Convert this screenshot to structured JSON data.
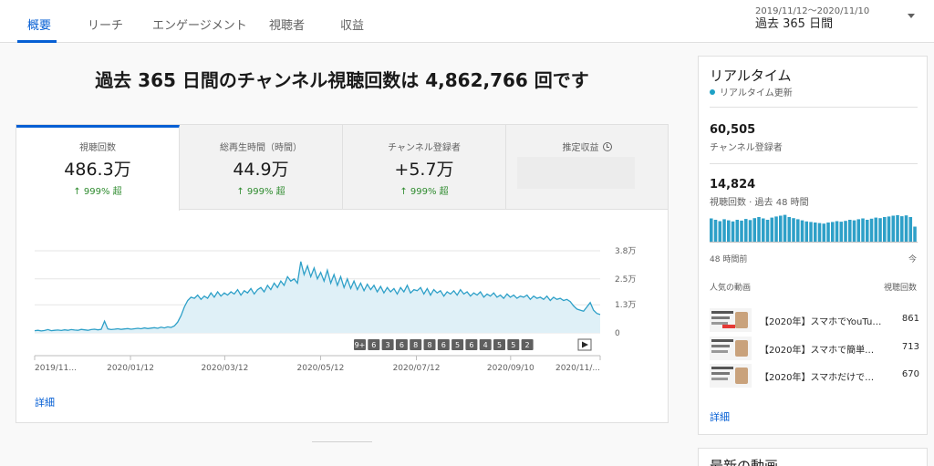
{
  "tabs": [
    {
      "label": "概要"
    },
    {
      "label": "リーチ"
    },
    {
      "label": "エンゲージメント"
    },
    {
      "label": "視聴者"
    },
    {
      "label": "収益"
    }
  ],
  "date_selector": {
    "range": "2019/11/12〜2020/11/10",
    "label": "過去 365 日間"
  },
  "headline": "過去 365 日間のチャンネル視聴回数は 4,862,766 回です",
  "metrics": [
    {
      "label": "視聴回数",
      "value": "486.3万",
      "delta": "↑ 999% 超"
    },
    {
      "label": "総再生時間（時間）",
      "value": "44.9万",
      "delta": "↑ 999% 超"
    },
    {
      "label": "チャンネル登録者",
      "value": "+5.7万",
      "delta": "↑ 999% 超"
    },
    {
      "label": "推定収益"
    }
  ],
  "chart_data": {
    "type": "area",
    "y_ticks": [
      "3.8万",
      "2.5万",
      "1.3万",
      "0"
    ],
    "ylim": [
      0,
      38000
    ],
    "x_labels": [
      "2019/11...",
      "2020/01/12",
      "2020/03/12",
      "2020/05/12",
      "2020/07/12",
      "2020/09/10",
      "2020/11/..."
    ],
    "x_dates": [
      "2019-11-12",
      "2020-01-12",
      "2020-03-12",
      "2020-05-12",
      "2020-07-12",
      "2020-09-10",
      "2020-11-06"
    ],
    "series": [
      {
        "color": "#2ea0c8",
        "values": [
          1000,
          1200,
          900,
          1100,
          1500,
          1000,
          1200,
          1300,
          1100,
          1400,
          1200,
          1500,
          1300,
          1200,
          1600,
          1400,
          1200,
          1500,
          1700,
          1400,
          1600,
          5400,
          1800,
          1500,
          1700,
          1900,
          1600,
          1800,
          2000,
          1700,
          1900,
          2100,
          1900,
          2300,
          2000,
          2200,
          2400,
          2100,
          2600,
          2300,
          2800,
          2500,
          3200,
          5000,
          8000,
          12000,
          15000,
          16500,
          16000,
          17500,
          15500,
          17000,
          16000,
          18500,
          16500,
          19000,
          17000,
          18500,
          17500,
          19000,
          18000,
          20000,
          17500,
          19500,
          18500,
          20500,
          18000,
          20000,
          21000,
          19000,
          22000,
          20000,
          23000,
          21000,
          24000,
          22000,
          26000,
          24000,
          25000,
          23000,
          33000,
          27000,
          31000,
          26000,
          30000,
          25000,
          28000,
          24000,
          29000,
          23000,
          27000,
          22000,
          26000,
          21000,
          25000,
          20500,
          24000,
          20000,
          23000,
          19500,
          22500,
          20000,
          22000,
          19000,
          21500,
          18500,
          21000,
          19000,
          20500,
          18000,
          21000,
          19000,
          22000,
          18500,
          20000,
          19500,
          21000,
          18000,
          20500,
          17500,
          20000,
          18500,
          19500,
          17000,
          19000,
          18000,
          19500,
          17500,
          20000,
          18000,
          19000,
          17000,
          18500,
          17500,
          19000,
          16500,
          18000,
          17000,
          18500,
          16500,
          17500,
          16000,
          18000,
          16500,
          17500,
          16000,
          17000,
          16500,
          17500,
          15500,
          17000,
          16000,
          16500,
          15500,
          17000,
          15000,
          16500,
          15500,
          16000,
          15000,
          15500,
          14500,
          12500,
          11000,
          10500,
          10000,
          12000,
          14000,
          10500,
          9000,
          8500
        ]
      }
    ]
  },
  "chart_controls": {
    "markers": [
      "9+",
      "6",
      "3",
      "6",
      "8",
      "8",
      "6",
      "5",
      "6",
      "4",
      "5",
      "5",
      "2"
    ]
  },
  "main_more": "詳細",
  "realtime": {
    "title": "リアルタイム",
    "live_label": "リアルタイム更新",
    "subscribers": "60,505",
    "subscribers_label": "チャンネル登録者",
    "views": "14,824",
    "views_label": "視聴回数 · 過去 48 時間",
    "bars": [
      0.85,
      0.8,
      0.75,
      0.82,
      0.78,
      0.74,
      0.8,
      0.77,
      0.83,
      0.79,
      0.86,
      0.9,
      0.85,
      0.8,
      0.88,
      0.92,
      0.95,
      0.98,
      0.9,
      0.86,
      0.82,
      0.78,
      0.74,
      0.72,
      0.7,
      0.68,
      0.66,
      0.7,
      0.72,
      0.75,
      0.73,
      0.76,
      0.8,
      0.78,
      0.82,
      0.85,
      0.8,
      0.84,
      0.88,
      0.86,
      0.9,
      0.92,
      0.95,
      0.97,
      0.93,
      0.96,
      0.9,
      0.55
    ],
    "axis_left": "48 時間前",
    "axis_right": "今",
    "popular_label": "人気の動画",
    "views_col": "視聴回数",
    "videos": [
      {
        "title": "【2020年】スマホでYouTu…",
        "views": "861"
      },
      {
        "title": "【2020年】スマホで簡単に…",
        "views": "713"
      },
      {
        "title": "【2020年】スマホだけで簡…",
        "views": "670"
      }
    ],
    "more": "詳細"
  },
  "latest": {
    "title": "最新の動画"
  }
}
